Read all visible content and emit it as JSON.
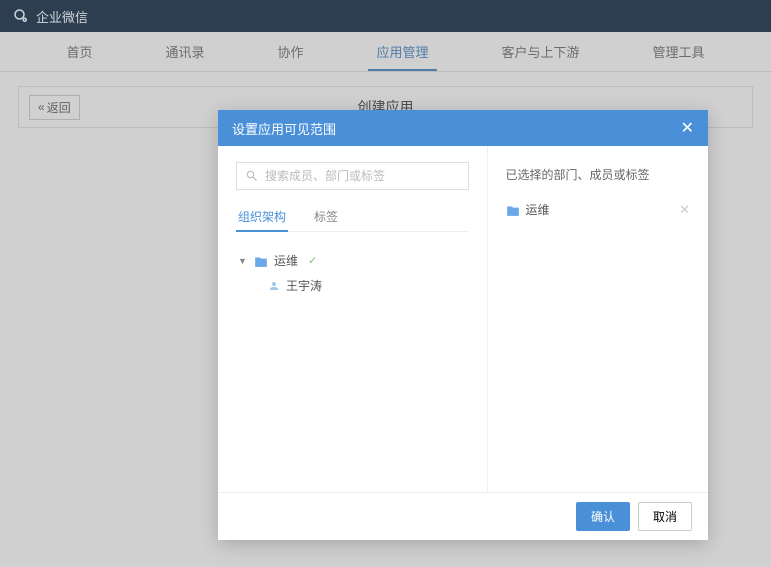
{
  "app": {
    "name": "企业微信"
  },
  "nav": {
    "items": [
      {
        "label": "首页"
      },
      {
        "label": "通讯录"
      },
      {
        "label": "协作"
      },
      {
        "label": "应用管理"
      },
      {
        "label": "客户与上下游"
      },
      {
        "label": "管理工具"
      }
    ],
    "active_index": 3
  },
  "page": {
    "back_label": "返回",
    "title": "创建应用"
  },
  "modal": {
    "title": "设置应用可见范围",
    "search_placeholder": "搜索成员、部门或标签",
    "tabs": {
      "org": "组织架构",
      "tags": "标签"
    },
    "tree": {
      "dept": "运维",
      "member": "王宇涛"
    },
    "selected_title": "已选择的部门、成员或标签",
    "selected": [
      {
        "label": "运维"
      }
    ],
    "confirm": "确认",
    "cancel": "取消"
  }
}
